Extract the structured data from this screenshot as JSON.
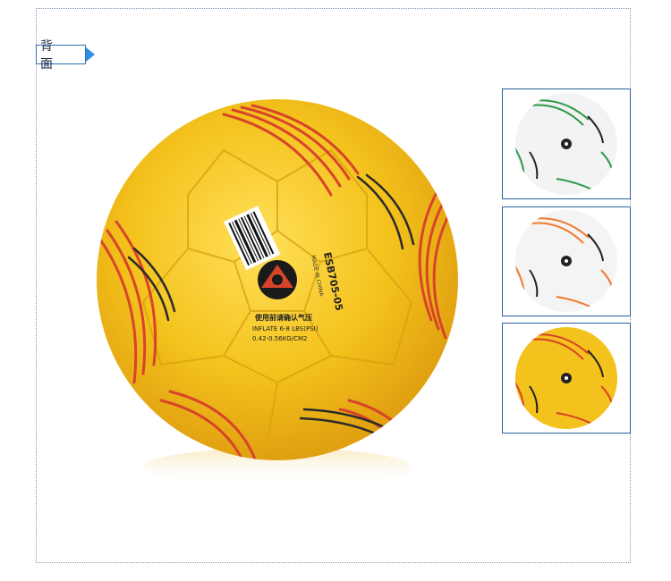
{
  "section": {
    "label": "背 面"
  },
  "ball_print": {
    "model": "ESB705-05",
    "made_in": "MADE IN CHINA",
    "cn_note": "使用前请确认气压",
    "inflate": "INFLATE 6-8 LBS(PSI)",
    "pressure": "0.42-0.56KG/CM2"
  },
  "colors": {
    "frame": "#7f97b3",
    "tag_border": "#2b6fb8",
    "tag_arrow": "#2f8fe0",
    "thumb_border": "#2b5fa0",
    "ball_yellow": "#f4c21c",
    "stripe_red": "#d8442a"
  },
  "thumbnails": [
    {
      "variant": "green-white"
    },
    {
      "variant": "orange-white"
    },
    {
      "variant": "yellow-red"
    }
  ]
}
